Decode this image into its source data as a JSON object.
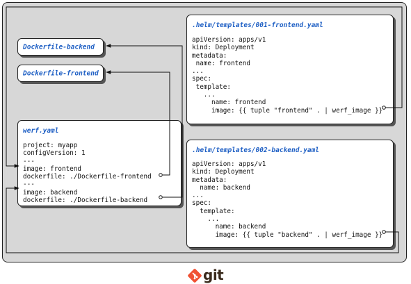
{
  "files": {
    "backend_dockerfile": {
      "title": "Dockerfile-backend"
    },
    "frontend_dockerfile": {
      "title": "Dockerfile-frontend"
    },
    "werf": {
      "title": "werf.yaml",
      "lines": [
        "project: myapp",
        "configVersion: 1",
        "---",
        "image: frontend",
        "dockerfile: ./Dockerfile-frontend",
        "---",
        "image: backend",
        "dockerfile: ./Dockerfile-backend"
      ]
    },
    "frontend_template": {
      "title": ".helm/templates/001-frontend.yaml",
      "lines": [
        "apiVersion: apps/v1",
        "kind: Deployment",
        "metadata:",
        " name: frontend",
        "...",
        "spec:",
        " template:",
        "   ...",
        "     name: frontend",
        "     image: {{ tuple \"frontend\" . | werf_image }}"
      ]
    },
    "backend_template": {
      "title": ".helm/templates/002-backend.yaml",
      "lines": [
        "apiVersion: apps/v1",
        "kind: Deployment",
        "metadata:",
        "  name: backend",
        "...",
        "spec:",
        "  template:",
        "    ...",
        "      name: backend",
        "      image: {{ tuple \"backend\" . | werf_image }}"
      ]
    }
  },
  "logo": {
    "text": "git",
    "color": "#f05133"
  },
  "colors": {
    "title": "#1e5fc4",
    "repo_bg": "#d7d7d7"
  }
}
